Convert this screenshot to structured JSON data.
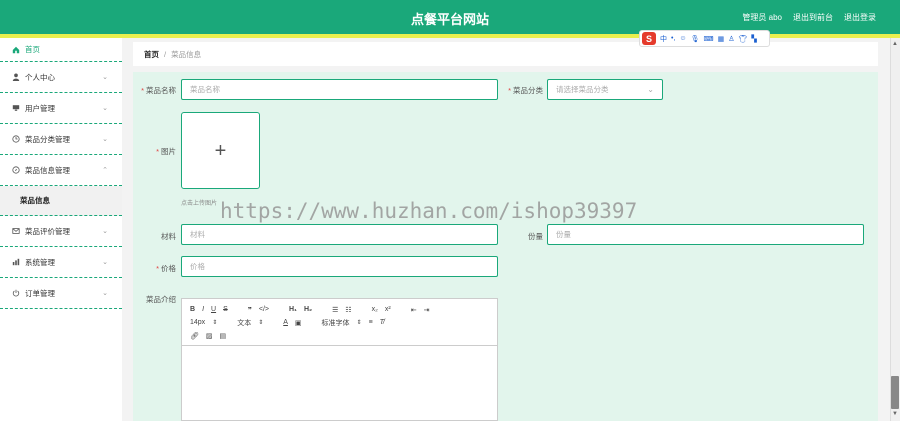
{
  "header": {
    "title": "点餐平台网站",
    "links": [
      "管理员 abo",
      "退出到前台",
      "退出登录"
    ]
  },
  "sidebar": {
    "items": [
      {
        "label": "首页",
        "icon": "home-icon"
      },
      {
        "label": "个人中心",
        "icon": "user-icon"
      },
      {
        "label": "用户管理",
        "icon": "monitor-icon"
      },
      {
        "label": "菜品分类管理",
        "icon": "clock-icon"
      },
      {
        "label": "菜品信息管理",
        "icon": "compass-icon"
      },
      {
        "label": "菜品评价管理",
        "icon": "message-icon"
      },
      {
        "label": "系统管理",
        "icon": "chart-icon"
      },
      {
        "label": "订单管理",
        "icon": "power-icon"
      }
    ],
    "sub_item": "菜品信息"
  },
  "breadcrumb": {
    "home": "首页",
    "separator": "/",
    "current": "菜品信息"
  },
  "form": {
    "name_label": "菜品名称",
    "name_placeholder": "菜品名称",
    "category_label": "菜品分类",
    "category_placeholder": "请选择菜品分类",
    "image_label": "图片",
    "upload_hint": "点击上传图片",
    "material_label": "材料",
    "material_placeholder": "材料",
    "portion_label": "份量",
    "portion_placeholder": "份量",
    "price_label": "价格",
    "price_placeholder": "价格",
    "intro_label": "菜品介绍"
  },
  "editor": {
    "font_size": "14px",
    "text_style": "文本",
    "font_family": "标准字体"
  },
  "watermark": "https://www.huzhan.com/ishop39397",
  "ime": {
    "mode": "中"
  },
  "colors": {
    "primary": "#1aa87a",
    "accent_bar": "#e9ef4e",
    "form_bg": "#e2f5ec",
    "required": "#e04040"
  }
}
